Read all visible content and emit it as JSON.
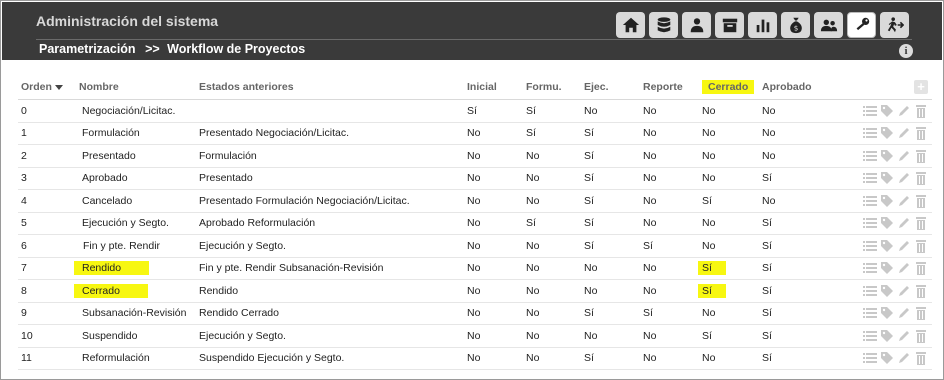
{
  "header": {
    "app_title": "Administración del sistema",
    "breadcrumb_root": "Parametrización",
    "breadcrumb_sep": ">>",
    "breadcrumb_current": "Workflow de Proyectos",
    "info_label": "i",
    "nav_icons": [
      "home-icon",
      "database-icon",
      "users-icon",
      "archive-icon",
      "bar-chart-icon",
      "money-bag-icon",
      "user-group-icon",
      "key-icon",
      "exit-icon"
    ]
  },
  "table": {
    "columns": [
      "Orden",
      "Nombre",
      "Estados anteriores",
      "Inicial",
      "Formu.",
      "Ejec.",
      "Reporte",
      "Cerrado",
      "Aprobado"
    ],
    "add_label": "+",
    "rows": [
      {
        "orden": "0",
        "nombre": "Negociación/Licitac.",
        "anteriores": "",
        "inicial": "Sí",
        "formu": "Sí",
        "ejec": "No",
        "reporte": "No",
        "cerrado": "No",
        "aprobado": "No"
      },
      {
        "orden": "1",
        "nombre": "Formulación",
        "anteriores": "Presentado Negociación/Licitac.",
        "inicial": "No",
        "formu": "Sí",
        "ejec": "Sí",
        "reporte": "No",
        "cerrado": "No",
        "aprobado": "No"
      },
      {
        "orden": "2",
        "nombre": "Presentado",
        "anteriores": "Formulación",
        "inicial": "No",
        "formu": "No",
        "ejec": "Sí",
        "reporte": "No",
        "cerrado": "No",
        "aprobado": "No"
      },
      {
        "orden": "3",
        "nombre": "Aprobado",
        "anteriores": "Presentado",
        "inicial": "No",
        "formu": "No",
        "ejec": "Sí",
        "reporte": "No",
        "cerrado": "No",
        "aprobado": "Sí"
      },
      {
        "orden": "4",
        "nombre": "Cancelado",
        "anteriores": "Presentado Formulación Negociación/Licitac.",
        "inicial": "No",
        "formu": "No",
        "ejec": "Sí",
        "reporte": "No",
        "cerrado": "Sí",
        "aprobado": "No"
      },
      {
        "orden": "5",
        "nombre": "Ejecución y Segto.",
        "anteriores": "Aprobado Reformulación",
        "inicial": "No",
        "formu": "Sí",
        "ejec": "Sí",
        "reporte": "No",
        "cerrado": "No",
        "aprobado": "Sí"
      },
      {
        "orden": "6",
        "nombre": "Fin y pte. Rendir",
        "anteriores": "Ejecución y Segto.",
        "inicial": "No",
        "formu": "No",
        "ejec": "Sí",
        "reporte": "Sí",
        "cerrado": "No",
        "aprobado": "Sí"
      },
      {
        "orden": "7",
        "nombre": "Rendido",
        "anteriores": "Fin y pte. Rendir Subsanación-Revisión",
        "inicial": "No",
        "formu": "No",
        "ejec": "No",
        "reporte": "No",
        "cerrado": "Sí",
        "aprobado": "Sí"
      },
      {
        "orden": "8",
        "nombre": "Cerrado",
        "anteriores": "Rendido",
        "inicial": "No",
        "formu": "No",
        "ejec": "No",
        "reporte": "No",
        "cerrado": "Sí",
        "aprobado": "Sí"
      },
      {
        "orden": "9",
        "nombre": "Subsanación-Revisión",
        "anteriores": "Rendido Cerrado",
        "inicial": "No",
        "formu": "No",
        "ejec": "Sí",
        "reporte": "Sí",
        "cerrado": "No",
        "aprobado": "Sí"
      },
      {
        "orden": "10",
        "nombre": "Suspendido",
        "anteriores": "Ejecución y Segto.",
        "inicial": "No",
        "formu": "No",
        "ejec": "No",
        "reporte": "No",
        "cerrado": "Sí",
        "aprobado": "Sí"
      },
      {
        "orden": "11",
        "nombre": "Reformulación",
        "anteriores": "Suspendido Ejecución y Segto.",
        "inicial": "No",
        "formu": "No",
        "ejec": "Sí",
        "reporte": "No",
        "cerrado": "No",
        "aprobado": "Sí"
      }
    ]
  },
  "colors": {
    "header_bg": "#3a3a3a",
    "highlight": "#f7f711"
  }
}
